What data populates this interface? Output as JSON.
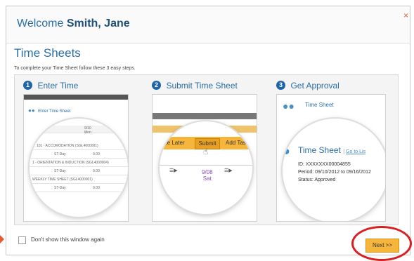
{
  "header": {
    "welcome_prefix": "Welcome",
    "user_name": "Smith, Jane",
    "close_label": "×"
  },
  "main": {
    "title": "Time Sheets",
    "instructions": "To complete your Time Sheet follow these 3 easy steps."
  },
  "steps": [
    {
      "number": "1",
      "label": "Enter Time",
      "mini_title": "Enter Time Sheet",
      "rows": [
        {
          "text": "101 - ACCOMODATION (SGL4000001)"
        },
        {
          "text": "ST-Day",
          "value": "0.00"
        },
        {
          "text": "1 - ORIENTATION & INDUCTION (SGL4000004)"
        },
        {
          "text": "ST-Day",
          "value": "0.00"
        },
        {
          "text": "WEEKLY TIME SHEET (SGL4000001)"
        },
        {
          "text": "ST-Day",
          "value": "0.00"
        }
      ],
      "col_header": "9/10",
      "col_sub": "Mon"
    },
    {
      "number": "2",
      "label": "Submit Time Sheet",
      "buttons": [
        "ete Later",
        "Submit",
        "Add Tas"
      ],
      "date": "9/08",
      "day": "Sat"
    },
    {
      "number": "3",
      "label": "Get Approval",
      "sheet_title": "Time Sheet",
      "link": "Go to Lis",
      "id_label": "ID:",
      "id_value": "XXXXXXX00004855",
      "period_label": "Period:",
      "period_value": "09/10/2012 to 09/16/2012",
      "status_label": "Status:",
      "status_value": "Approved"
    }
  ],
  "footer": {
    "checkbox_label": "Don't show this window again",
    "next_label": "Next >>"
  },
  "colors": {
    "accent": "#2a6ea6",
    "button": "#f6b53b",
    "highlight_ring": "#d91f1f"
  }
}
